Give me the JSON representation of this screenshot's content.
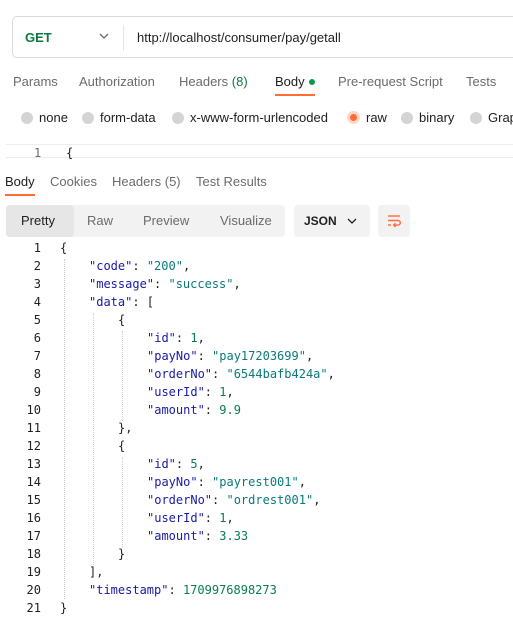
{
  "request": {
    "method": "GET",
    "url": "http://localhost/consumer/pay/getall"
  },
  "request_tabs": [
    {
      "label": "Params"
    },
    {
      "label": "Authorization"
    },
    {
      "label": "Headers",
      "count": "(8)"
    },
    {
      "label": "Body",
      "active": true,
      "indicator_color": "#0b9b4a"
    },
    {
      "label": "Pre-request Script"
    },
    {
      "label": "Tests"
    }
  ],
  "body_modes": [
    {
      "label": "none"
    },
    {
      "label": "form-data"
    },
    {
      "label": "x-www-form-urlencoded"
    },
    {
      "label": "raw",
      "selected": true
    },
    {
      "label": "binary"
    },
    {
      "label": "Grap"
    }
  ],
  "request_editor": {
    "line_number": "1",
    "code": "{"
  },
  "response_tabs": [
    {
      "label": "Body",
      "active": true
    },
    {
      "label": "Cookies"
    },
    {
      "label": "Headers (5)"
    },
    {
      "label": "Test Results"
    }
  ],
  "view_modes": [
    {
      "label": "Pretty",
      "active": true
    },
    {
      "label": "Raw"
    },
    {
      "label": "Preview"
    },
    {
      "label": "Visualize"
    }
  ],
  "format": {
    "selected": "JSON"
  },
  "colors": {
    "accent": "#ff6c37",
    "method_get": "#0b7a3e",
    "json_key": "#1a1aa6",
    "json_string": "#0a7a7a",
    "json_number": "#097d50"
  },
  "response_lines": [
    {
      "n": "1",
      "indent": 0,
      "tokens": [
        {
          "t": "p",
          "v": "{"
        }
      ]
    },
    {
      "n": "2",
      "indent": 1,
      "tokens": [
        {
          "t": "k",
          "v": "\"code\""
        },
        {
          "t": "p",
          "v": ": "
        },
        {
          "t": "s",
          "v": "\"200\""
        },
        {
          "t": "p",
          "v": ","
        }
      ]
    },
    {
      "n": "3",
      "indent": 1,
      "tokens": [
        {
          "t": "k",
          "v": "\"message\""
        },
        {
          "t": "p",
          "v": ": "
        },
        {
          "t": "s",
          "v": "\"success\""
        },
        {
          "t": "p",
          "v": ","
        }
      ]
    },
    {
      "n": "4",
      "indent": 1,
      "tokens": [
        {
          "t": "k",
          "v": "\"data\""
        },
        {
          "t": "p",
          "v": ": ["
        }
      ]
    },
    {
      "n": "5",
      "indent": 2,
      "tokens": [
        {
          "t": "p",
          "v": "{"
        }
      ]
    },
    {
      "n": "6",
      "indent": 3,
      "tokens": [
        {
          "t": "k",
          "v": "\"id\""
        },
        {
          "t": "p",
          "v": ": "
        },
        {
          "t": "n",
          "v": "1"
        },
        {
          "t": "p",
          "v": ","
        }
      ]
    },
    {
      "n": "7",
      "indent": 3,
      "tokens": [
        {
          "t": "k",
          "v": "\"payNo\""
        },
        {
          "t": "p",
          "v": ": "
        },
        {
          "t": "s",
          "v": "\"pay17203699\""
        },
        {
          "t": "p",
          "v": ","
        }
      ]
    },
    {
      "n": "8",
      "indent": 3,
      "tokens": [
        {
          "t": "k",
          "v": "\"orderNo\""
        },
        {
          "t": "p",
          "v": ": "
        },
        {
          "t": "s",
          "v": "\"6544bafb424a\""
        },
        {
          "t": "p",
          "v": ","
        }
      ]
    },
    {
      "n": "9",
      "indent": 3,
      "tokens": [
        {
          "t": "k",
          "v": "\"userId\""
        },
        {
          "t": "p",
          "v": ": "
        },
        {
          "t": "n",
          "v": "1"
        },
        {
          "t": "p",
          "v": ","
        }
      ]
    },
    {
      "n": "10",
      "indent": 3,
      "tokens": [
        {
          "t": "k",
          "v": "\"amount\""
        },
        {
          "t": "p",
          "v": ": "
        },
        {
          "t": "n",
          "v": "9.9"
        }
      ]
    },
    {
      "n": "11",
      "indent": 2,
      "tokens": [
        {
          "t": "p",
          "v": "},"
        }
      ]
    },
    {
      "n": "12",
      "indent": 2,
      "tokens": [
        {
          "t": "p",
          "v": "{"
        }
      ]
    },
    {
      "n": "13",
      "indent": 3,
      "tokens": [
        {
          "t": "k",
          "v": "\"id\""
        },
        {
          "t": "p",
          "v": ": "
        },
        {
          "t": "n",
          "v": "5"
        },
        {
          "t": "p",
          "v": ","
        }
      ]
    },
    {
      "n": "14",
      "indent": 3,
      "tokens": [
        {
          "t": "k",
          "v": "\"payNo\""
        },
        {
          "t": "p",
          "v": ": "
        },
        {
          "t": "s",
          "v": "\"payrest001\""
        },
        {
          "t": "p",
          "v": ","
        }
      ]
    },
    {
      "n": "15",
      "indent": 3,
      "tokens": [
        {
          "t": "k",
          "v": "\"orderNo\""
        },
        {
          "t": "p",
          "v": ": "
        },
        {
          "t": "s",
          "v": "\"ordrest001\""
        },
        {
          "t": "p",
          "v": ","
        }
      ]
    },
    {
      "n": "16",
      "indent": 3,
      "tokens": [
        {
          "t": "k",
          "v": "\"userId\""
        },
        {
          "t": "p",
          "v": ": "
        },
        {
          "t": "n",
          "v": "1"
        },
        {
          "t": "p",
          "v": ","
        }
      ]
    },
    {
      "n": "17",
      "indent": 3,
      "tokens": [
        {
          "t": "k",
          "v": "\"amount\""
        },
        {
          "t": "p",
          "v": ": "
        },
        {
          "t": "n",
          "v": "3.33"
        }
      ]
    },
    {
      "n": "18",
      "indent": 2,
      "tokens": [
        {
          "t": "p",
          "v": "}"
        }
      ]
    },
    {
      "n": "19",
      "indent": 1,
      "tokens": [
        {
          "t": "p",
          "v": "],"
        }
      ]
    },
    {
      "n": "20",
      "indent": 1,
      "tokens": [
        {
          "t": "k",
          "v": "\"timestamp\""
        },
        {
          "t": "p",
          "v": ": "
        },
        {
          "t": "n",
          "v": "1709976898273"
        }
      ]
    },
    {
      "n": "21",
      "indent": 0,
      "tokens": [
        {
          "t": "p",
          "v": "}"
        }
      ]
    }
  ]
}
